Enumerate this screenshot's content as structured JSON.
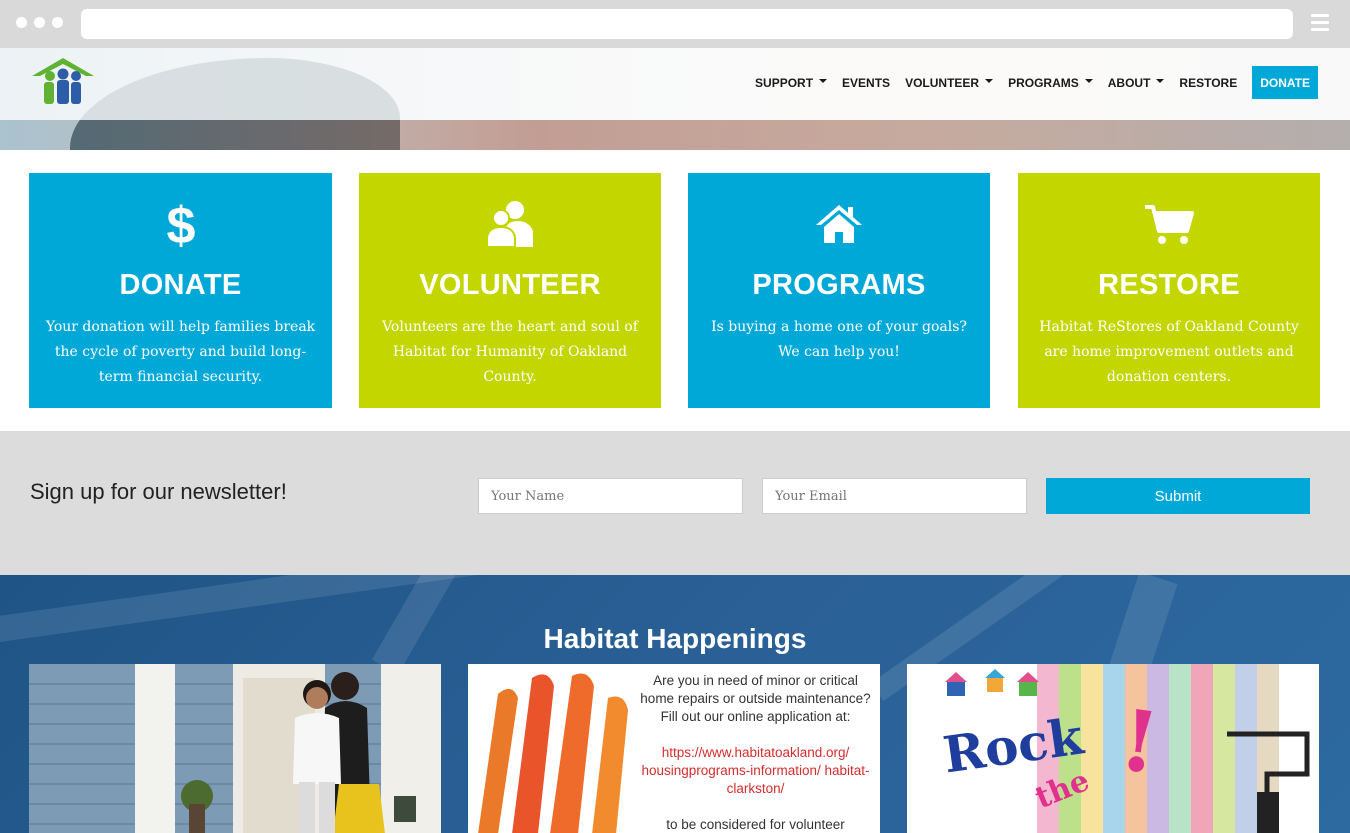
{
  "nav": {
    "items": [
      {
        "label": "SUPPORT",
        "dropdown": true
      },
      {
        "label": "EVENTS",
        "dropdown": false
      },
      {
        "label": "VOLUNTEER",
        "dropdown": true
      },
      {
        "label": "PROGRAMS",
        "dropdown": true
      },
      {
        "label": "ABOUT",
        "dropdown": true
      },
      {
        "label": "RESTORE",
        "dropdown": false
      }
    ],
    "donate_label": "DONATE"
  },
  "cards": [
    {
      "icon": "dollar-icon",
      "title": "DONATE",
      "text": "Your donation will help families break the cycle of poverty and build long-term financial security.",
      "color": "#00a8d8"
    },
    {
      "icon": "people-icon",
      "title": "VOLUNTEER",
      "text": "Volunteers are the heart and soul of Habitat for Humanity of Oakland County.",
      "color": "#c4d600"
    },
    {
      "icon": "home-icon",
      "title": "PROGRAMS",
      "text": "Is buying a home one of your goals? We can help you!",
      "color": "#00a8d8"
    },
    {
      "icon": "cart-icon",
      "title": "RESTORE",
      "text": "Habitat ReStores of Oakland County are home improvement outlets and donation centers.",
      "color": "#c4d600"
    }
  ],
  "newsletter": {
    "title": "Sign up for our newsletter!",
    "name_placeholder": "Your Name",
    "email_placeholder": "Your Email",
    "submit_label": "Submit"
  },
  "happenings": {
    "title": "Habitat Happenings",
    "tile2": {
      "text": "Are you in need of minor or critical home repairs or outside maintenance? Fill out our online application at:",
      "link": "https://www.habitatoakland.org/ housingprograms-information/ habitat-clarkston/",
      "tail": "to be considered for volunteer"
    },
    "tile3": {
      "rock": "Rock",
      "the": "the",
      "bang": "!"
    }
  },
  "colors": {
    "accent_blue": "#00a8d8",
    "accent_green": "#c4d600",
    "happenings_bg": "#2a6096"
  }
}
